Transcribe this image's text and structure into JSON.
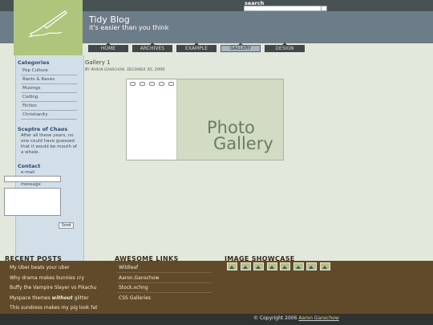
{
  "header": {
    "title": "Tidy Blog",
    "tagline": "it's easier than you think",
    "search_label": "search",
    "search_value": ""
  },
  "nav": {
    "tabs": [
      "HOME",
      "ARCHIVES",
      "EXAMPLE",
      "GALLERY",
      "DESIGN"
    ],
    "active": "GALLERY"
  },
  "sidebar": {
    "categories_title": "Categories",
    "categories": [
      "Pop Culture",
      "Rants & Raves",
      "Musings",
      "Coding",
      "Fiction",
      "Christianity"
    ],
    "sceptre_title": "Sceptre of Chaos",
    "sceptre_text": "After all these years, no one could have guessed that it would be mouth of a whale.",
    "contact_title": "Contact",
    "email_label": "e-mail",
    "message_label": "message",
    "send_label": "Send"
  },
  "post": {
    "title": "Gallery 1",
    "byline": "By Aaron Ganschow, December 30, 2006",
    "image_line1": "Photo",
    "image_line2": "Gallery"
  },
  "footer": {
    "recent_title": "RECENT POSTS",
    "recent": [
      {
        "text": "My Uber beats your uber"
      },
      {
        "text": "Why drama makes bunnies cry"
      },
      {
        "text": "Buffy the Vampire Slayer vs Pikachu"
      },
      {
        "pre": "Myspace themes ",
        "em": "without",
        "post": " glitter"
      },
      {
        "text": "This sundress makes my pig look fat"
      }
    ],
    "links_title": "AWESOME LINKS",
    "links": [
      "Wildleaf",
      "Aaron.Ganschow",
      "Stock.xchng",
      "CSS Galleries"
    ],
    "showcase_title": "IMAGE SHOWCASE",
    "copyright_prefix": "© Copyright 2006 ",
    "copyright_name": "Aaron Ganschow"
  },
  "colors": {
    "logo_green": "#b0c57c",
    "header_blue": "#6c7c88",
    "footer_brown": "#604a2a",
    "sidebar_blue": "#d2dee8"
  }
}
